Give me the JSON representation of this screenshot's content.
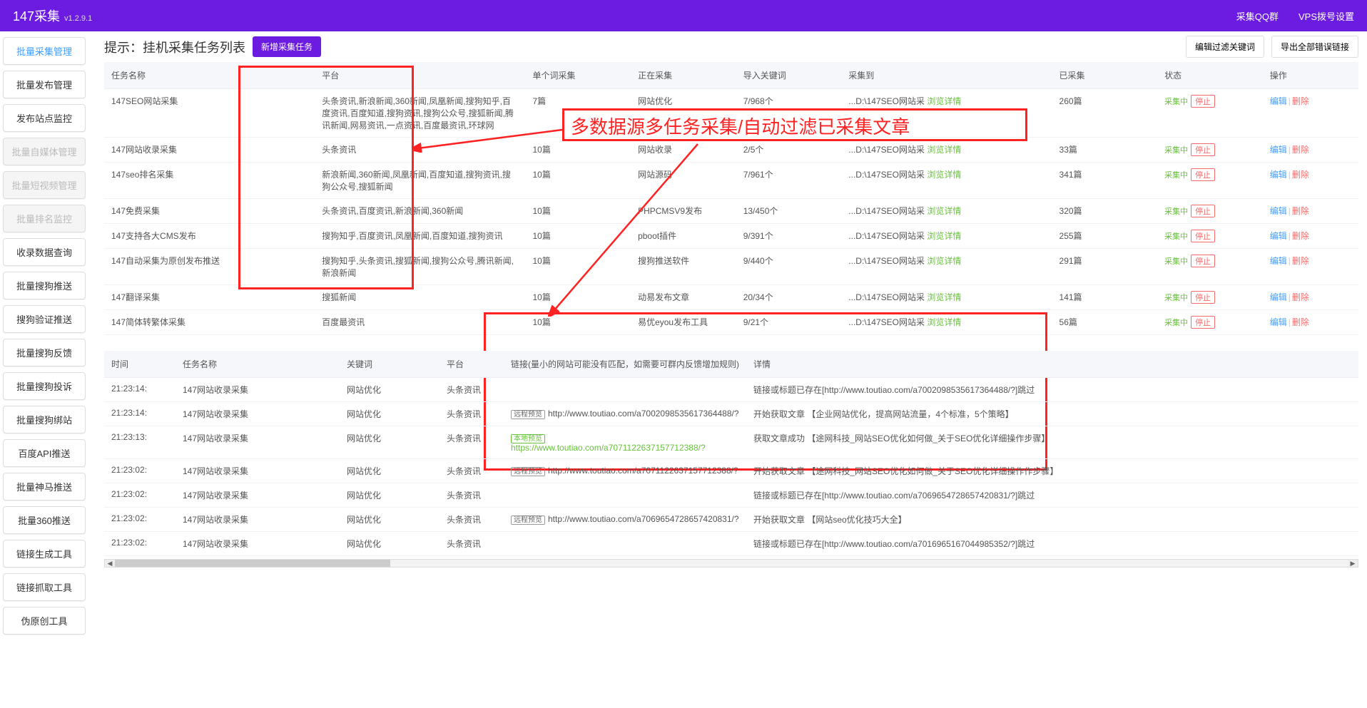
{
  "header": {
    "title": "147采集",
    "version": "v1.2.9.1",
    "right_links": [
      "采集QQ群",
      "VPS拨号设置"
    ]
  },
  "sidebar": {
    "items": [
      {
        "label": "批量采集管理",
        "state": "active"
      },
      {
        "label": "批量发布管理",
        "state": "normal"
      },
      {
        "label": "发布站点监控",
        "state": "normal"
      },
      {
        "label": "批量自媒体管理",
        "state": "disabled"
      },
      {
        "label": "批量短视频管理",
        "state": "disabled"
      },
      {
        "label": "批量排名监控",
        "state": "disabled"
      },
      {
        "label": "收录数据查询",
        "state": "normal"
      },
      {
        "label": "批量搜狗推送",
        "state": "normal"
      },
      {
        "label": "搜狗验证推送",
        "state": "normal"
      },
      {
        "label": "批量搜狗反馈",
        "state": "normal"
      },
      {
        "label": "批量搜狗投诉",
        "state": "normal"
      },
      {
        "label": "批量搜狗绑站",
        "state": "normal"
      },
      {
        "label": "百度API推送",
        "state": "normal"
      },
      {
        "label": "批量神马推送",
        "state": "normal"
      },
      {
        "label": "批量360推送",
        "state": "normal"
      },
      {
        "label": "链接生成工具",
        "state": "normal"
      },
      {
        "label": "链接抓取工具",
        "state": "normal"
      },
      {
        "label": "伪原创工具",
        "state": "normal"
      }
    ]
  },
  "panel": {
    "title": "提示：挂机采集任务列表",
    "add_btn": "新增采集任务",
    "filter_btn": "编辑过滤关键词",
    "export_btn": "导出全部错误链接"
  },
  "task_table": {
    "headers": [
      "任务名称",
      "平台",
      "单个词采集",
      "正在采集",
      "导入关键词",
      "采集到",
      "已采集",
      "状态",
      "操作"
    ],
    "status_txt": "采集中",
    "stop_txt": "停止",
    "edit_txt": "编辑",
    "delete_txt": "删除",
    "detail_txt": "浏览详情",
    "rows": [
      {
        "name": "147SEO网站采集",
        "platform": "头条资讯,新浪新闻,360新闻,凤凰新闻,搜狗知乎,百度资讯,百度知道,搜狗资讯,搜狗公众号,搜狐新闻,腾讯新闻,网易资讯,一点资讯,百度最资讯,环球网",
        "word": "7篇",
        "collecting": "网站优化",
        "imported": "7/968个",
        "target": "...D:\\147SEO网站采",
        "count": "260篇"
      },
      {
        "name": "147网站收录采集",
        "platform": "头条资讯",
        "word": "10篇",
        "collecting": "网站收录",
        "imported": "2/5个",
        "target": "...D:\\147SEO网站采",
        "count": "33篇"
      },
      {
        "name": "147seo排名采集",
        "platform": "新浪新闻,360新闻,凤凰新闻,百度知道,搜狗资讯,搜狗公众号,搜狐新闻",
        "word": "10篇",
        "collecting": "网站源码",
        "imported": "7/961个",
        "target": "...D:\\147SEO网站采",
        "count": "341篇"
      },
      {
        "name": "147免费采集",
        "platform": "头条资讯,百度资讯,新浪新闻,360新闻",
        "word": "10篇",
        "collecting": "PHPCMSV9发布",
        "imported": "13/450个",
        "target": "...D:\\147SEO网站采",
        "count": "320篇"
      },
      {
        "name": "147支持各大CMS发布",
        "platform": "搜狗知乎,百度资讯,凤凰新闻,百度知道,搜狗资讯",
        "word": "10篇",
        "collecting": "pboot插件",
        "imported": "9/391个",
        "target": "...D:\\147SEO网站采",
        "count": "255篇"
      },
      {
        "name": "147自动采集为原创发布推送",
        "platform": "搜狗知乎,头条资讯,搜狐新闻,搜狗公众号,腾讯新闻,新浪新闻",
        "word": "10篇",
        "collecting": "搜狗推送软件",
        "imported": "9/440个",
        "target": "...D:\\147SEO网站采",
        "count": "291篇"
      },
      {
        "name": "147翻译采集",
        "platform": "搜狐新闻",
        "word": "10篇",
        "collecting": "动易发布文章",
        "imported": "20/34个",
        "target": "...D:\\147SEO网站采",
        "count": "141篇"
      },
      {
        "name": "147简体转繁体采集",
        "platform": "百度最资讯",
        "word": "10篇",
        "collecting": "易优eyou发布工具",
        "imported": "9/21个",
        "target": "...D:\\147SEO网站采",
        "count": "56篇"
      }
    ]
  },
  "annotation": {
    "text": "多数据源多任务采集/自动过滤已采集文章"
  },
  "log_table": {
    "headers": [
      "时间",
      "任务名称",
      "关键词",
      "平台",
      "链接(量小的网站可能没有匹配，如需要可群内反馈增加规则)",
      "详情"
    ],
    "badge_remote": "远程预览",
    "badge_local": "本地预览",
    "rows": [
      {
        "time": "21:23:14:",
        "task": "147网站收录采集",
        "kw": "网站优化",
        "plat": "头条资讯",
        "link_type": "",
        "url": "",
        "detail": "链接或标题已存在[http://www.toutiao.com/a7002098535617364488/?]跳过"
      },
      {
        "time": "21:23:14:",
        "task": "147网站收录采集",
        "kw": "网站优化",
        "plat": "头条资讯",
        "link_type": "remote",
        "url": "http://www.toutiao.com/a7002098535617364488/?",
        "detail": "开始获取文章 【企业网站优化，提高网站流量，4个标准，5个策略】"
      },
      {
        "time": "21:23:13:",
        "task": "147网站收录采集",
        "kw": "网站优化",
        "plat": "头条资讯",
        "link_type": "local",
        "url": "https://www.toutiao.com/a7071122637157712388/?",
        "detail": "获取文章成功 【途网科技_网站SEO优化如何做_关于SEO优化详细操作步骤】"
      },
      {
        "time": "21:23:02:",
        "task": "147网站收录采集",
        "kw": "网站优化",
        "plat": "头条资讯",
        "link_type": "remote",
        "url": "http://www.toutiao.com/a7071122637157712388/?",
        "detail": "开始获取文章 【途网科技_网站SEO优化如何做_关于SEO优化详细操作作步骤】"
      },
      {
        "time": "21:23:02:",
        "task": "147网站收录采集",
        "kw": "网站优化",
        "plat": "头条资讯",
        "link_type": "",
        "url": "",
        "detail": "链接或标题已存在[http://www.toutiao.com/a7069654728657420831/?]跳过"
      },
      {
        "time": "21:23:02:",
        "task": "147网站收录采集",
        "kw": "网站优化",
        "plat": "头条资讯",
        "link_type": "remote",
        "url": "http://www.toutiao.com/a7069654728657420831/?",
        "detail": "开始获取文章 【网站seo优化技巧大全】"
      },
      {
        "time": "21:23:02:",
        "task": "147网站收录采集",
        "kw": "网站优化",
        "plat": "头条资讯",
        "link_type": "",
        "url": "",
        "detail": "链接或标题已存在[http://www.toutiao.com/a7016965167044985352/?]跳过"
      }
    ]
  }
}
